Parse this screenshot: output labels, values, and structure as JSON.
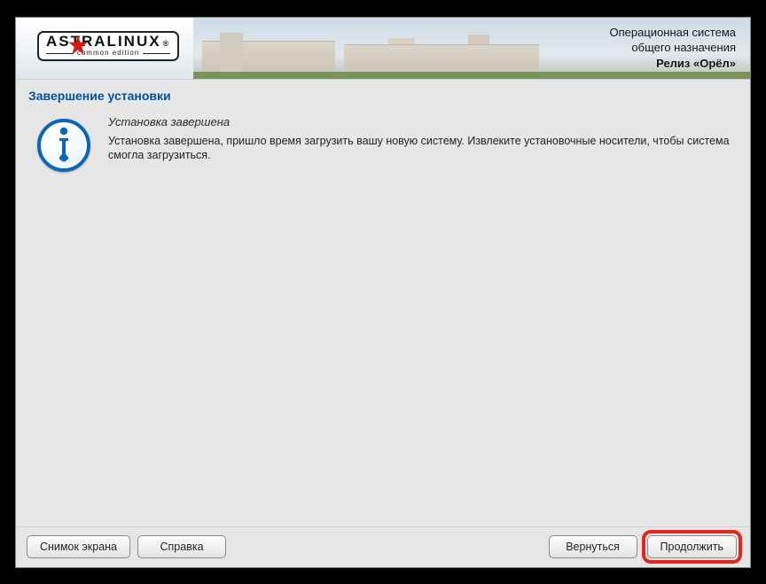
{
  "banner": {
    "logo_main": "ASTRALINUX",
    "logo_reg": "®",
    "logo_sub": "common edition",
    "line1": "Операционная система",
    "line2": "общего назначения",
    "release": "Релиз «Орёл»"
  },
  "page": {
    "title": "Завершение установки"
  },
  "message": {
    "heading": "Установка завершена",
    "body": "Установка завершена, пришло время загрузить вашу новую систему. Извлеките установочные носители, чтобы система смогла загрузиться."
  },
  "buttons": {
    "screenshot": "Снимок экрана",
    "help": "Справка",
    "back": "Вернуться",
    "continue": "Продолжить"
  },
  "colors": {
    "accent": "#0a66b6",
    "title": "#00529c",
    "highlight": "#e1261c"
  }
}
